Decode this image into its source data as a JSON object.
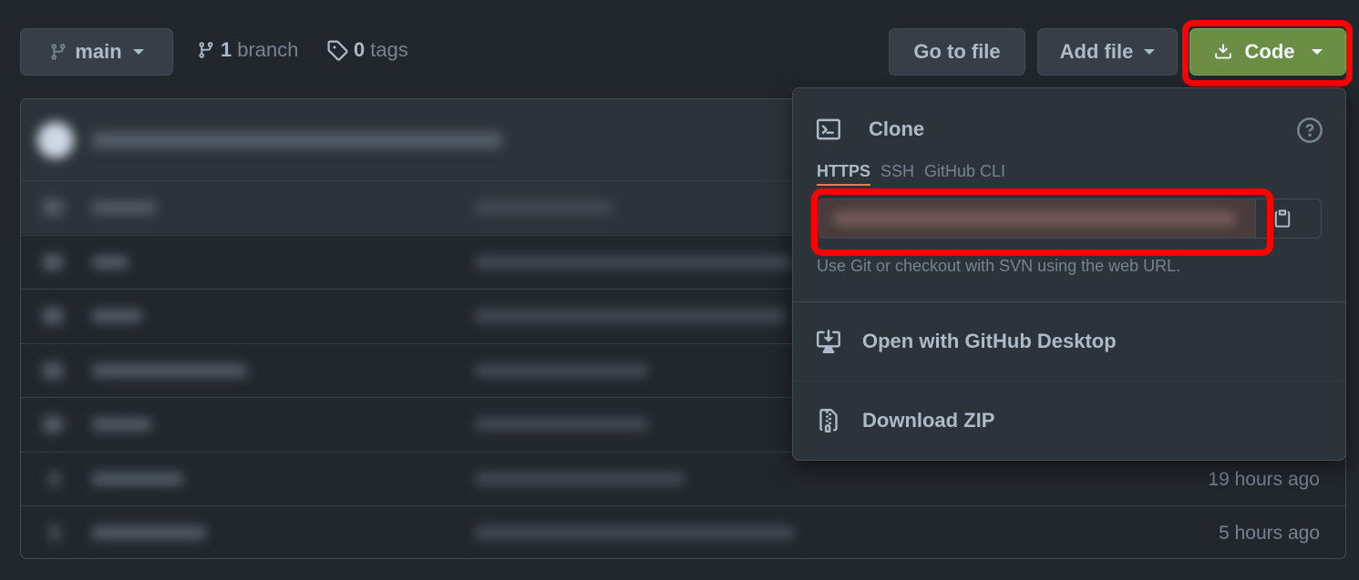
{
  "toolbar": {
    "branch_select": "main",
    "branches_count": "1",
    "branches_label": "branch",
    "tags_count": "0",
    "tags_label": "tags",
    "go_to_file": "Go to file",
    "add_file": "Add file",
    "code": "Code"
  },
  "files": [
    {
      "time": ""
    },
    {
      "time": ""
    },
    {
      "time": ""
    },
    {
      "time": ""
    },
    {
      "time": ""
    },
    {
      "time": "19 hours ago"
    },
    {
      "time": "5 hours ago"
    }
  ],
  "clone": {
    "title": "Clone",
    "tabs": [
      "HTTPS",
      "SSH",
      "GitHub CLI"
    ],
    "active_tab": "HTTPS",
    "url_value": "",
    "hint": "Use Git or checkout with SVN using the web URL.",
    "open_desktop": "Open with GitHub Desktop",
    "download_zip": "Download ZIP"
  },
  "colors": {
    "background": "#22272e",
    "code_button": "#6b8e44",
    "highlight": "#ff0000",
    "active_tab_underline": "#ec775c"
  }
}
